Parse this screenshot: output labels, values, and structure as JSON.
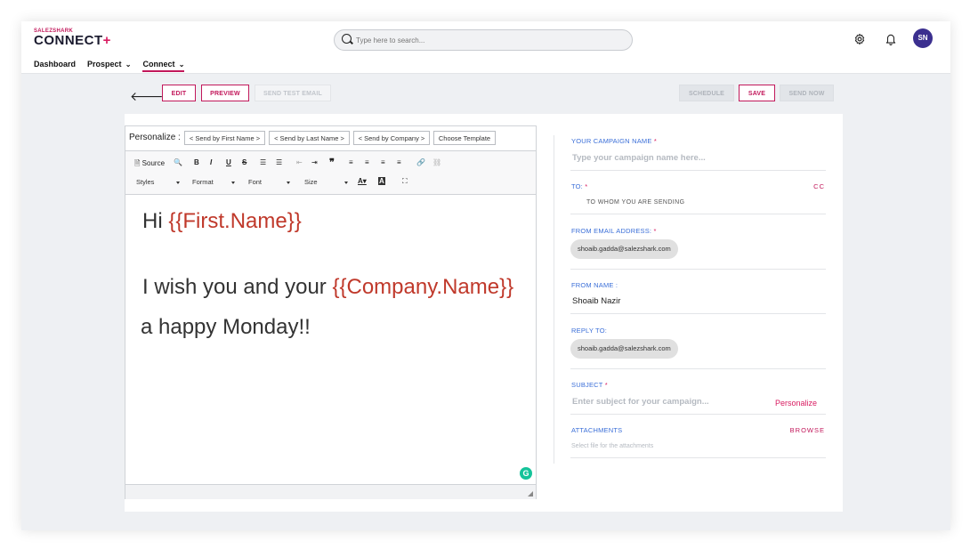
{
  "header": {
    "logo_small": "SALEZSHARK",
    "logo_main": "CONNECT",
    "logo_plus": "+",
    "search_placeholder": "Type here to search...",
    "avatar_initials": "SN",
    "nav": [
      {
        "label": "Dashboard"
      },
      {
        "label": "Prospect"
      },
      {
        "label": "Connect"
      }
    ]
  },
  "actions": {
    "edit": "EDIT",
    "preview": "PREVIEW",
    "send_test": "SEND TEST EMAIL",
    "schedule": "SCHEDULE",
    "save": "SAVE",
    "send_now": "SEND NOW"
  },
  "editor": {
    "personalize_label": "Personalize :",
    "personalize_buttons": [
      "< Send by First Name >",
      "< Send by Last Name >",
      "< Send by Company >",
      "Choose Template"
    ],
    "toolbar": {
      "source": "Source",
      "styles": "Styles",
      "format": "Format",
      "font": "Font",
      "size": "Size"
    },
    "body": {
      "line1_prefix": "Hi ",
      "line1_placeholder": "{{First.Name}}",
      "line2_prefix": "I wish you and your ",
      "line2_placeholder": "{{Company.Name}}",
      "line3": "a happy Monday!!"
    }
  },
  "form": {
    "campaign_name_label": "YOUR CAMPAIGN NAME",
    "campaign_name_placeholder": "Type your campaign name here...",
    "to_label": "TO:",
    "cc_label": "CC",
    "to_hint": "TO WHOM YOU ARE SENDING",
    "from_email_label": "FROM EMAIL ADDRESS:",
    "from_email_value": "shoaib.gadda@salezshark.com",
    "from_name_label": "FROM NAME :",
    "from_name_value": "Shoaib Nazir",
    "reply_to_label": "REPLY TO:",
    "reply_to_value": "shoaib.gadda@salezshark.com",
    "subject_label": "SUBJECT",
    "subject_placeholder": "Enter subject for your campaign...",
    "subject_personalize": "Personalize",
    "attachments_label": "ATTACHMENTS",
    "browse_label": "BROWSE",
    "attachments_hint": "Select file for the attachments",
    "required_mark": "*"
  },
  "colors": {
    "accent": "#c2185b",
    "link_blue": "#3b6fd8",
    "placeholder_red": "#c0392b",
    "avatar_bg": "#3b2f8f"
  }
}
